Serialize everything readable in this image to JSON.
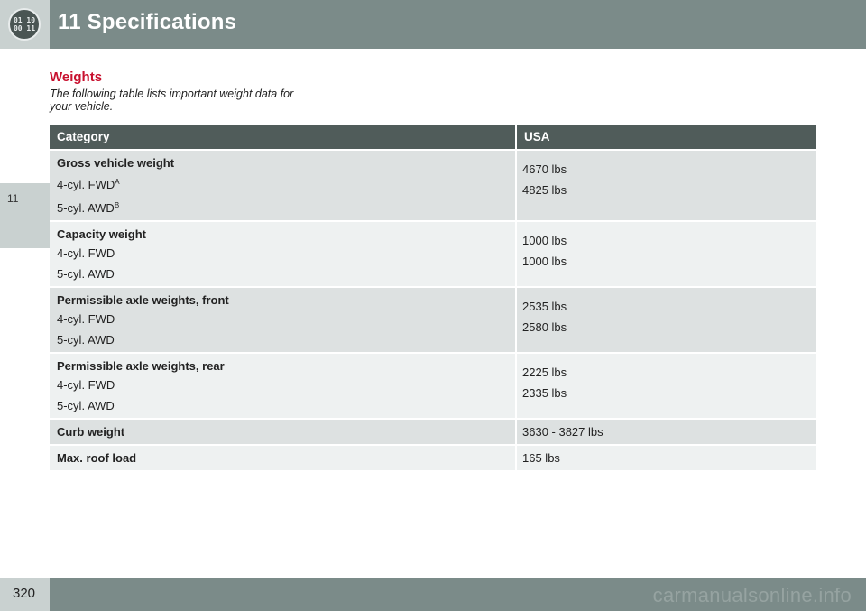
{
  "header": {
    "logo_text": "01 10\n00 11",
    "title": "11 Specifications"
  },
  "side_tab": {
    "label": "11"
  },
  "section": {
    "heading": "Weights",
    "intro": "The following table lists important weight data for your vehicle."
  },
  "table": {
    "columns": [
      "Category",
      "USA"
    ],
    "rows": [
      {
        "category": "Gross vehicle weight",
        "subitems": [
          {
            "label": "4-cyl. FWD",
            "sup": "A",
            "value": "4670 lbs"
          },
          {
            "label": "5-cyl. AWD",
            "sup": "B",
            "value": "4825 lbs"
          }
        ]
      },
      {
        "category": "Capacity weight",
        "subitems": [
          {
            "label": "4-cyl. FWD",
            "value": "1000 lbs"
          },
          {
            "label": "5-cyl. AWD",
            "value": "1000 lbs"
          }
        ]
      },
      {
        "category": "Permissible axle weights, front",
        "subitems": [
          {
            "label": "4-cyl. FWD",
            "value": "2535 lbs"
          },
          {
            "label": "5-cyl. AWD",
            "value": "2580 lbs"
          }
        ]
      },
      {
        "category": "Permissible axle weights, rear",
        "subitems": [
          {
            "label": "4-cyl. FWD",
            "value": "2225 lbs"
          },
          {
            "label": "5-cyl. AWD",
            "value": "2335 lbs"
          }
        ]
      },
      {
        "category": "Curb weight",
        "value": "3630 - 3827 lbs"
      },
      {
        "category": "Max. roof load",
        "value": "165 lbs"
      }
    ]
  },
  "footer": {
    "page_number": "320",
    "watermark": "carmanualsonline.info"
  }
}
